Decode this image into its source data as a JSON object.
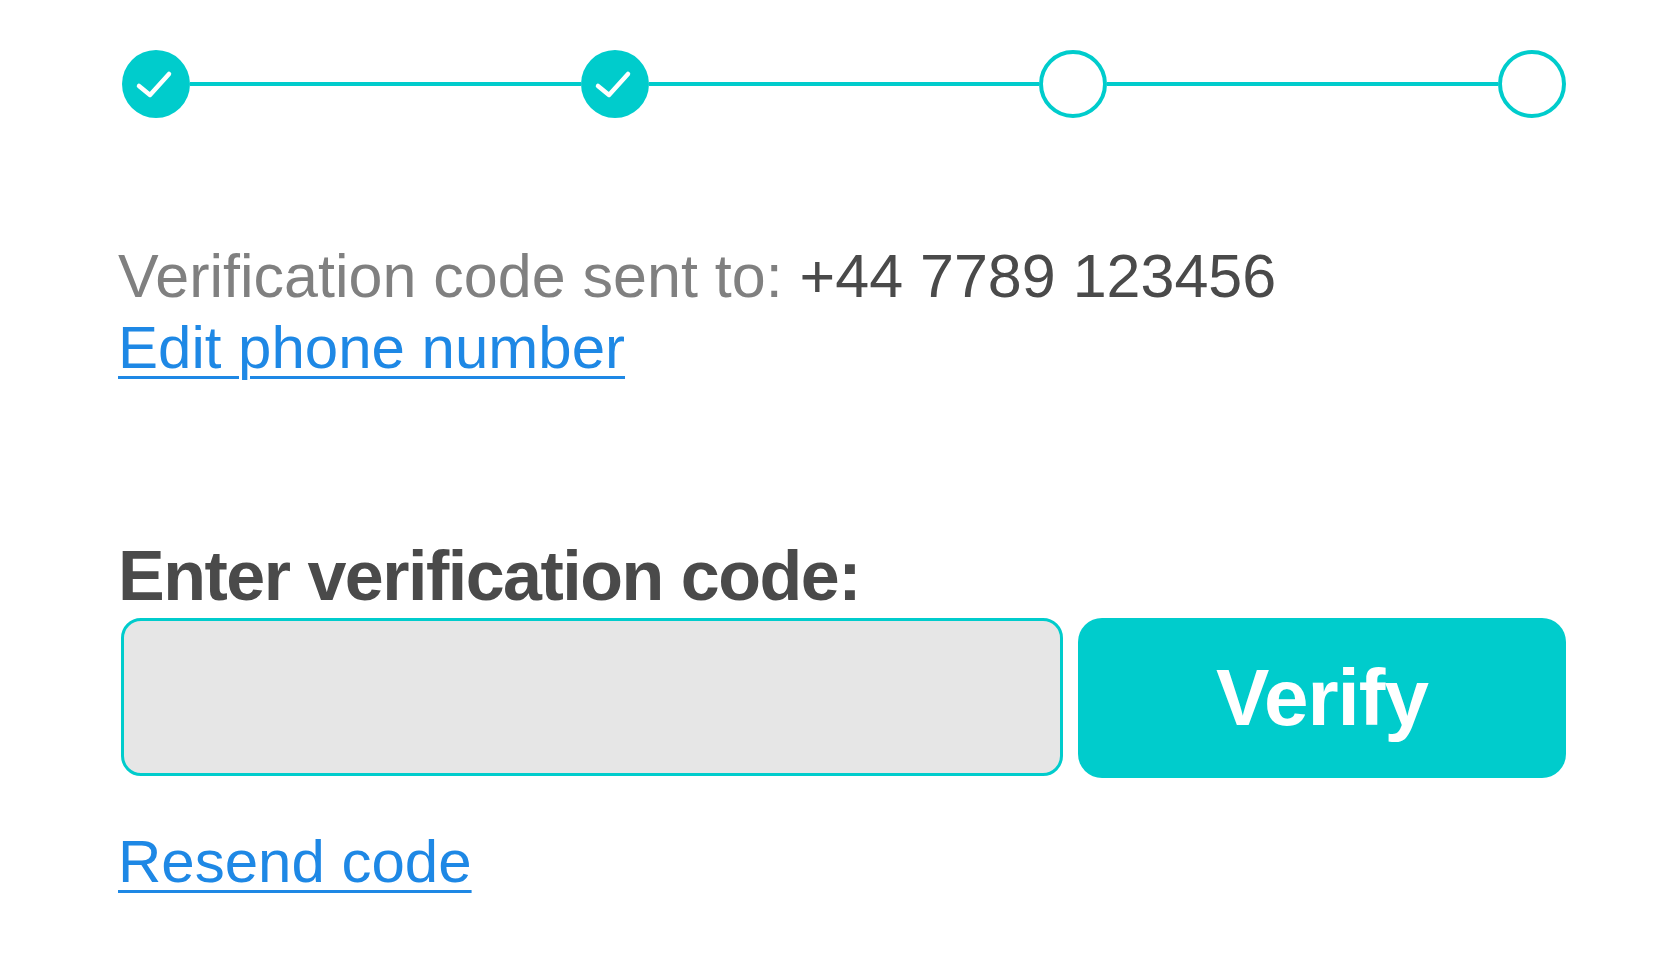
{
  "stepper": {
    "steps": [
      {
        "done": true
      },
      {
        "done": true
      },
      {
        "done": false
      },
      {
        "done": false
      }
    ]
  },
  "verification": {
    "sent_to_label": "Verification code sent to:",
    "phone_number": "+44 7789 123456",
    "edit_link": "Edit phone number"
  },
  "code_entry": {
    "label": "Enter verification code:",
    "button": "Verify"
  },
  "resend_link": "Resend code"
}
